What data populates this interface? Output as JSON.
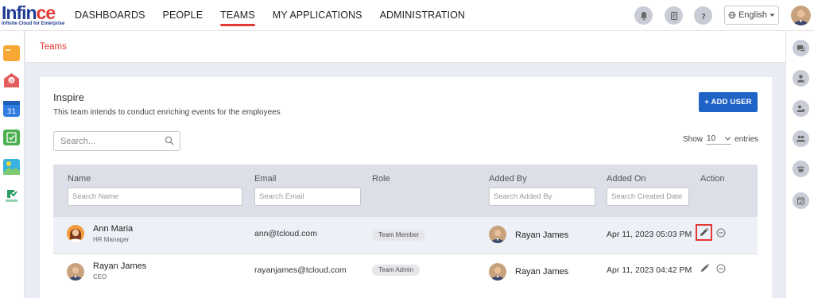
{
  "brand": {
    "logo_main_prefix": "Infin",
    "logo_main_accent": "ce",
    "logo_subtitle": "Infinite Cloud for Enterprise"
  },
  "nav": {
    "items": [
      {
        "label": "DASHBOARDS"
      },
      {
        "label": "PEOPLE"
      },
      {
        "label": "TEAMS",
        "active": true
      },
      {
        "label": "MY APPLICATIONS"
      },
      {
        "label": "ADMINISTRATION"
      }
    ],
    "icons": [
      "bell-icon",
      "task-report-icon",
      "help-icon"
    ],
    "language": "English",
    "accent_color": "#e53935"
  },
  "breadcrumb": {
    "current": "Teams"
  },
  "team": {
    "name": "Inspire",
    "description": "This team intends to conduct enriching events for the employees",
    "add_user_label": "+ ADD USER"
  },
  "search": {
    "placeholder": "Search..."
  },
  "entries": {
    "show_label": "Show",
    "value": "10",
    "entries_label": "entries"
  },
  "table": {
    "columns": [
      {
        "label": "Name",
        "filter_placeholder": "Search Name"
      },
      {
        "label": "Email",
        "filter_placeholder": "Search Email"
      },
      {
        "label": "Role"
      },
      {
        "label": "Added By",
        "filter_placeholder": "Search Added By"
      },
      {
        "label": "Added On",
        "filter_placeholder": "Search Created Date"
      },
      {
        "label": "Action"
      }
    ],
    "rows": [
      {
        "name": "Ann Maria",
        "title": "HR Manager",
        "email": "ann@tcloud.com",
        "role": "Team Member",
        "added_by": "Rayan James",
        "added_on": "Apr 11, 2023 05:03 PM"
      },
      {
        "name": "Rayan James",
        "title": "CEO",
        "email": "rayanjames@tcloud.com",
        "role": "Team Admin",
        "added_by": "Rayan James",
        "added_on": "Apr 11, 2023 04:42 PM"
      }
    ]
  },
  "colors": {
    "primary_button": "#1f63c6",
    "header_bg": "#dcdfe8",
    "page_bg": "#e9ebf5"
  }
}
